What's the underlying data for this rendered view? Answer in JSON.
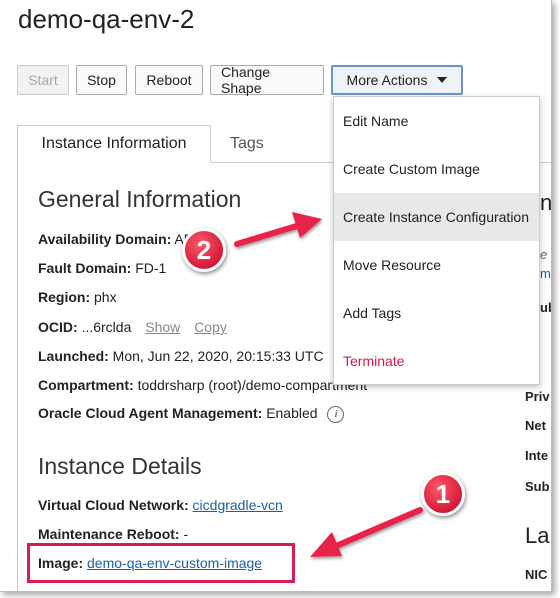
{
  "page": {
    "title": "demo-qa-env-2"
  },
  "toolbar": {
    "start": "Start",
    "stop": "Stop",
    "reboot": "Reboot",
    "change_shape": "Change Shape",
    "more_actions": "More Actions"
  },
  "tabs": {
    "instance_info": "Instance Information",
    "tags": "Tags"
  },
  "general": {
    "heading": "General Information",
    "availability_domain_label": "Availability Domain:",
    "availability_domain_value": "AD",
    "fault_domain_label": "Fault Domain:",
    "fault_domain_value": "FD-1",
    "region_label": "Region:",
    "region_value": "phx",
    "ocid_label": "OCID:",
    "ocid_value": "...6rclda",
    "ocid_show": "Show",
    "ocid_copy": "Copy",
    "launched_label": "Launched:",
    "launched_value": "Mon, Jun 22, 2020, 20:15:33 UTC",
    "compartment_label": "Compartment:",
    "compartment_value": "toddrsharp (root)/demo-compartment",
    "agent_label": "Oracle Cloud Agent Management:",
    "agent_value": "Enabled"
  },
  "details": {
    "heading": "Instance Details",
    "vcn_label": "Virtual Cloud Network:",
    "vcn_value": "cicdgradle-vcn",
    "maint_label": "Maintenance Reboot:",
    "maint_value": "-",
    "image_label": "Image:",
    "image_value": "demo-qa-env-custom-image"
  },
  "right_col": {
    "priv": "Priv",
    "net": "Net",
    "inte": "Inte",
    "sub": "Sub",
    "la": "La",
    "nic": "NIC",
    "ns": "ns",
    "e": "e",
    "m": "m",
    "ub": "ub"
  },
  "menu": {
    "items": [
      "Edit Name",
      "Create Custom Image",
      "Create Instance Configuration",
      "Move Resource",
      "Add Tags",
      "Terminate"
    ]
  },
  "annotations": {
    "badge1": "1",
    "badge2": "2"
  },
  "colors": {
    "accent": "#d31a47",
    "link": "#1a5fa8",
    "highlight": "#d81b50"
  }
}
